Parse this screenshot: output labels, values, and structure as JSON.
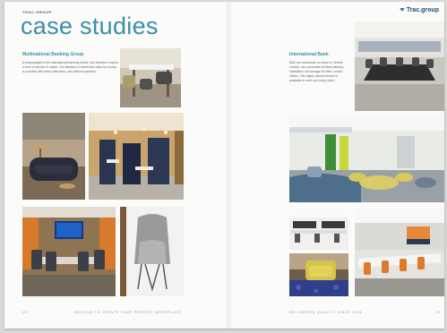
{
  "header": {
    "brand_small": "TRAC.GROUP",
    "title": "case studies",
    "logo_text": "Trac.group"
  },
  "left_case": {
    "heading": "Multinational Banking Group",
    "body": "A heavyweight in the international banking sector, and therefore require a level of service to match. Our attention to detail and value for money is included with every instruction, and without question."
  },
  "right_case": {
    "heading": "International Bank",
    "body": "With our warehouse so close to Central London, we coordinate furniture delivery, installation and storage for then London offices. This highly valued service is available to each and every client."
  },
  "footer": {
    "left_page_number": "18",
    "left_tagline": "HELPING TO CREATE YOUR PERFECT WORKPLACE",
    "right_tagline": "DELIVERING QUALITY SINCE 1984",
    "right_page_number": "19"
  },
  "colors": {
    "accent_teal": "#3a8fa6",
    "logo_navy": "#1a4e74"
  }
}
